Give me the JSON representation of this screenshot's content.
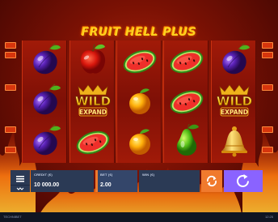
{
  "game": {
    "title": "FRUIT HELL PLUS"
  },
  "reels": [
    [
      "plum-icon",
      "plum-icon",
      "plum-icon"
    ],
    [
      "apple-icon",
      "wild-expand-icon",
      "watermelon-icon"
    ],
    [
      "watermelon-icon",
      "orange-icon",
      "orange-icon"
    ],
    [
      "watermelon-icon",
      "watermelon-icon",
      "pear-icon"
    ],
    [
      "plum-icon",
      "wild-expand-icon",
      "bell-icon"
    ]
  ],
  "wild": {
    "line1": "WILD",
    "line2": "EXPAND"
  },
  "panel": {
    "credit_label": "CREDIT (€)",
    "credit_value": "10 000.00",
    "bet_label": "BET (€)",
    "bet_value": "2.00",
    "win_label": "WIN (€)",
    "win_value": ""
  },
  "footer": {
    "brand": "TECHNIBET",
    "time": "12:25"
  },
  "colors": {
    "panel": "#2b3a55",
    "bet_accent": "#f07a2d",
    "spin": "#8a63ff",
    "autoplay": "#f07a2d"
  }
}
